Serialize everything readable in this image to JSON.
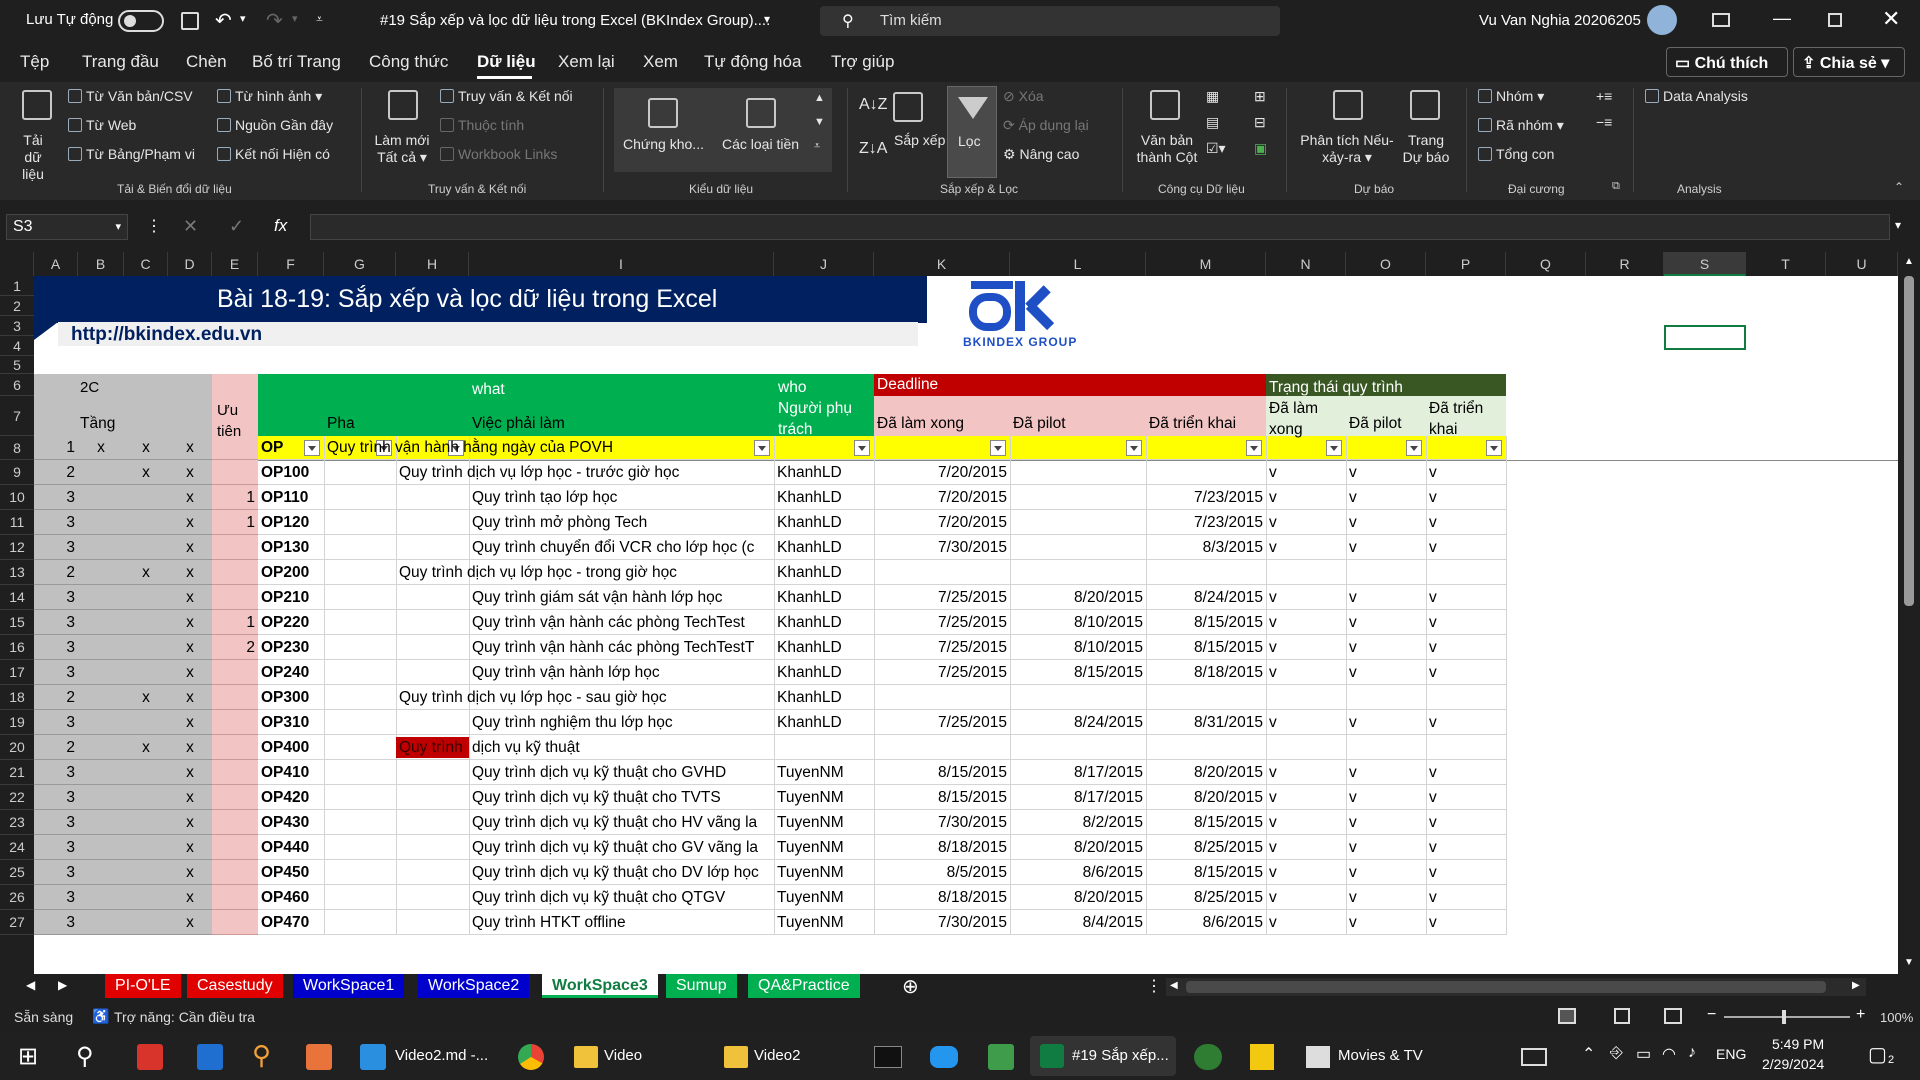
{
  "titlebar": {
    "autosave": "Lưu Tự động",
    "doc_title": "#19 Sắp xếp và lọc dữ liệu trong Excel (BKIndex Group)....",
    "search": "Tìm kiếm",
    "user": "Vu Van Nghia 20206205"
  },
  "menu": {
    "items": [
      "Tệp",
      "Trang đầu",
      "Chèn",
      "Bố trí Trang",
      "Công thức",
      "Dữ liệu",
      "Xem lại",
      "Xem",
      "Tự động hóa",
      "Trợ giúp"
    ],
    "comments": "Chú thích",
    "share": "Chia sẻ"
  },
  "ribbon": {
    "get_data": "Tải dữ liệu",
    "from_text": "Từ Văn bản/CSV",
    "from_web": "Từ Web",
    "from_table": "Từ Bảng/Phạm vi",
    "from_picture": "Từ hình ảnh",
    "recent_sources": "Nguồn Gần đây",
    "existing_conn": "Kết nối Hiện có",
    "group1": "Tải & Biến đổi dữ liệu",
    "refresh_all": "Làm mới Tất cả",
    "queries": "Truy vấn & Kết nối",
    "properties": "Thuộc tính",
    "workbook_links": "Workbook Links",
    "group2": "Truy vấn & Kết nối",
    "stocks": "Chứng kho...",
    "currencies": "Các loại tiền",
    "group3": "Kiểu dữ liệu",
    "sort": "Sắp xếp",
    "filter": "Lọc",
    "clear": "Xóa",
    "reapply": "Áp dụng lại",
    "advanced": "Nâng cao",
    "group4": "Sắp xếp & Lọc",
    "text_to_cols": "Văn bản thành Cột",
    "group5": "Công cụ Dữ liệu",
    "whatif": "Phân tích Nếu-xảy-ra",
    "forecast": "Trang Dự báo",
    "group6": "Dự báo",
    "group_btn": "Nhóm",
    "ungroup": "Rã nhóm",
    "subtotal": "Tổng con",
    "group7": "Đại cương",
    "data_analysis": "Data Analysis",
    "group8": "Analysis"
  },
  "formula": {
    "namebox": "S3",
    "fx": "fx",
    "value": ""
  },
  "columns": [
    "A",
    "B",
    "C",
    "D",
    "E",
    "F",
    "G",
    "H",
    "I",
    "J",
    "K",
    "L",
    "M",
    "N",
    "O",
    "P",
    "Q",
    "R",
    "S",
    "T",
    "U"
  ],
  "sheet": {
    "banner_title": "Bài 18-19:  Sắp xếp và lọc dữ liệu trong Excel",
    "banner_url": "http://bkindex.edu.vn",
    "logo_text": "BKINDEX GROUP",
    "hdr": {
      "a5": "",
      "b5": "2C",
      "b6": "Tầng",
      "e5": "Ưu tiên",
      "g6": "Pha",
      "i5": "what",
      "i6": "Việc phải làm",
      "j5": "who",
      "j6": "Người phụ trách",
      "k5": "Deadline",
      "k6": "Đã làm xong",
      "l6": "Đã pilot",
      "m6": "Đã triển khai",
      "n5": "Trạng thái quy trình",
      "n6": "Đã làm xong",
      "o6": "Đã pilot",
      "p6": "Đã triển khai"
    },
    "rows": [
      {
        "n": "8",
        "a": "1",
        "b": "x",
        "c": "x",
        "d": "x",
        "e": "",
        "f": "OP",
        "g": "Quy trình vận hành hằng ngày của POVH",
        "h": "",
        "i": "",
        "j": "",
        "k": "",
        "l": "",
        "m": "",
        "nn": "",
        "o": "",
        "p": ""
      },
      {
        "n": "9",
        "a": "2",
        "b": "",
        "c": "x",
        "d": "x",
        "e": "",
        "f": "OP100",
        "g": "",
        "h": "Quy trình dịch vụ lớp học - trước giờ học",
        "i": "",
        "j": "KhanhLD",
        "k": "7/20/2015",
        "l": "",
        "m": "",
        "nn": "v",
        "o": "v",
        "p": "v"
      },
      {
        "n": "10",
        "a": "3",
        "b": "",
        "c": "",
        "d": "x",
        "e": "1",
        "f": "OP110",
        "g": "",
        "h": "",
        "i": "Quy trình tạo lớp học",
        "j": "KhanhLD",
        "k": "7/20/2015",
        "l": "",
        "m": "7/23/2015",
        "nn": "v",
        "o": "v",
        "p": "v"
      },
      {
        "n": "11",
        "a": "3",
        "b": "",
        "c": "",
        "d": "x",
        "e": "1",
        "f": "OP120",
        "g": "",
        "h": "",
        "i": "Quy trình mở phòng Tech",
        "j": "KhanhLD",
        "k": "7/20/2015",
        "l": "",
        "m": "7/23/2015",
        "nn": "v",
        "o": "v",
        "p": "v"
      },
      {
        "n": "12",
        "a": "3",
        "b": "",
        "c": "",
        "d": "x",
        "e": "",
        "f": "OP130",
        "g": "",
        "h": "",
        "i": "Quy trình chuyển đổi VCR cho lớp học (c",
        "j": "KhanhLD",
        "k": "7/30/2015",
        "l": "",
        "m": "8/3/2015",
        "nn": "v",
        "o": "v",
        "p": "v"
      },
      {
        "n": "13",
        "a": "2",
        "b": "",
        "c": "x",
        "d": "x",
        "e": "",
        "f": "OP200",
        "g": "",
        "h": "Quy trình dịch vụ lớp học - trong giờ học",
        "i": "",
        "j": "KhanhLD",
        "k": "",
        "l": "",
        "m": "",
        "nn": "",
        "o": "",
        "p": ""
      },
      {
        "n": "14",
        "a": "3",
        "b": "",
        "c": "",
        "d": "x",
        "e": "",
        "f": "OP210",
        "g": "",
        "h": "",
        "i": "Quy trình giám sát vận hành lớp học",
        "j": "KhanhLD",
        "k": "7/25/2015",
        "l": "8/20/2015",
        "m": "8/24/2015",
        "nn": "v",
        "o": "v",
        "p": "v"
      },
      {
        "n": "15",
        "a": "3",
        "b": "",
        "c": "",
        "d": "x",
        "e": "1",
        "f": "OP220",
        "g": "",
        "h": "",
        "i": "Quy trình vận hành các phòng TechTest",
        "j": "KhanhLD",
        "k": "7/25/2015",
        "l": "8/10/2015",
        "m": "8/15/2015",
        "nn": "v",
        "o": "v",
        "p": "v"
      },
      {
        "n": "16",
        "a": "3",
        "b": "",
        "c": "",
        "d": "x",
        "e": "2",
        "f": "OP230",
        "g": "",
        "h": "",
        "i": "Quy trình vận hành các phòng TechTestT",
        "j": "KhanhLD",
        "k": "7/25/2015",
        "l": "8/10/2015",
        "m": "8/15/2015",
        "nn": "v",
        "o": "v",
        "p": "v"
      },
      {
        "n": "17",
        "a": "3",
        "b": "",
        "c": "",
        "d": "x",
        "e": "",
        "f": "OP240",
        "g": "",
        "h": "",
        "i": "Quy trình vận hành lớp học",
        "j": "KhanhLD",
        "k": "7/25/2015",
        "l": "8/15/2015",
        "m": "8/18/2015",
        "nn": "v",
        "o": "v",
        "p": "v"
      },
      {
        "n": "18",
        "a": "2",
        "b": "",
        "c": "x",
        "d": "x",
        "e": "",
        "f": "OP300",
        "g": "",
        "h": "Quy trình dịch vụ lớp học - sau giờ học",
        "i": "",
        "j": "KhanhLD",
        "k": "",
        "l": "",
        "m": "",
        "nn": "",
        "o": "",
        "p": ""
      },
      {
        "n": "19",
        "a": "3",
        "b": "",
        "c": "",
        "d": "x",
        "e": "",
        "f": "OP310",
        "g": "",
        "h": "",
        "i": "Quy trình nghiệm thu lớp học",
        "j": "KhanhLD",
        "k": "7/25/2015",
        "l": "8/24/2015",
        "m": "8/31/2015",
        "nn": "v",
        "o": "v",
        "p": "v"
      },
      {
        "n": "20",
        "a": "2",
        "b": "",
        "c": "x",
        "d": "x",
        "e": "",
        "f": "OP400",
        "g": "",
        "h": "Quy trình",
        "i": "dịch vụ kỹ thuật",
        "j": "",
        "k": "",
        "l": "",
        "m": "",
        "nn": "",
        "o": "",
        "p": ""
      },
      {
        "n": "21",
        "a": "3",
        "b": "",
        "c": "",
        "d": "x",
        "e": "",
        "f": "OP410",
        "g": "",
        "h": "",
        "i": "Quy trình dịch vụ kỹ thuật cho GVHD",
        "j": "TuyenNM",
        "k": "8/15/2015",
        "l": "8/17/2015",
        "m": "8/20/2015",
        "nn": "v",
        "o": "v",
        "p": "v"
      },
      {
        "n": "22",
        "a": "3",
        "b": "",
        "c": "",
        "d": "x",
        "e": "",
        "f": "OP420",
        "g": "",
        "h": "",
        "i": "Quy trình dịch vụ kỹ thuật cho TVTS",
        "j": "TuyenNM",
        "k": "8/15/2015",
        "l": "8/17/2015",
        "m": "8/20/2015",
        "nn": "v",
        "o": "v",
        "p": "v"
      },
      {
        "n": "23",
        "a": "3",
        "b": "",
        "c": "",
        "d": "x",
        "e": "",
        "f": "OP430",
        "g": "",
        "h": "",
        "i": "Quy trình dịch vụ kỹ thuật cho HV vãng la",
        "j": "TuyenNM",
        "k": "7/30/2015",
        "l": "8/2/2015",
        "m": "8/15/2015",
        "nn": "v",
        "o": "v",
        "p": "v"
      },
      {
        "n": "24",
        "a": "3",
        "b": "",
        "c": "",
        "d": "x",
        "e": "",
        "f": "OP440",
        "g": "",
        "h": "",
        "i": "Quy trình dịch vụ kỹ thuật cho GV vãng la",
        "j": "TuyenNM",
        "k": "8/18/2015",
        "l": "8/20/2015",
        "m": "8/25/2015",
        "nn": "v",
        "o": "v",
        "p": "v"
      },
      {
        "n": "25",
        "a": "3",
        "b": "",
        "c": "",
        "d": "x",
        "e": "",
        "f": "OP450",
        "g": "",
        "h": "",
        "i": "Quy trình dịch vụ kỹ thuật cho DV lớp học",
        "j": "TuyenNM",
        "k": "8/5/2015",
        "l": "8/6/2015",
        "m": "8/15/2015",
        "nn": "v",
        "o": "v",
        "p": "v"
      },
      {
        "n": "26",
        "a": "3",
        "b": "",
        "c": "",
        "d": "x",
        "e": "",
        "f": "OP460",
        "g": "",
        "h": "",
        "i": "Quy trình dịch vụ kỹ thuật cho QTGV",
        "j": "TuyenNM",
        "k": "8/18/2015",
        "l": "8/20/2015",
        "m": "8/25/2015",
        "nn": "v",
        "o": "v",
        "p": "v"
      },
      {
        "n": "27",
        "a": "3",
        "b": "",
        "c": "",
        "d": "x",
        "e": "",
        "f": "OP470",
        "g": "",
        "h": "",
        "i": "Quy trình HTKT offline",
        "j": "TuyenNM",
        "k": "7/30/2015",
        "l": "8/4/2015",
        "m": "8/6/2015",
        "nn": "v",
        "o": "v",
        "p": "v"
      }
    ]
  },
  "tabs": [
    {
      "label": "PI-O'LE",
      "color": "#e00000"
    },
    {
      "label": "Casestudy",
      "color": "#e00000"
    },
    {
      "label": "WorkSpace1",
      "color": "#0000cc"
    },
    {
      "label": "WorkSpace2",
      "color": "#0000cc"
    },
    {
      "label": "WorkSpace3",
      "color": "#00b050"
    },
    {
      "label": "Sumup",
      "color": "#00b050"
    },
    {
      "label": "QA&Practice",
      "color": "#00b050"
    }
  ],
  "status": {
    "ready": "Sẵn sàng",
    "accessibility": "Trợ năng: Cần điều tra",
    "zoom": "100%"
  },
  "taskbar": {
    "items": [
      "Video2.md -...",
      "Video",
      "Video2",
      "#19 Sắp xếp...",
      "Movies & TV"
    ],
    "lang": "ENG",
    "time": "5:49 PM",
    "date": "2/29/2024",
    "notif": "2"
  }
}
